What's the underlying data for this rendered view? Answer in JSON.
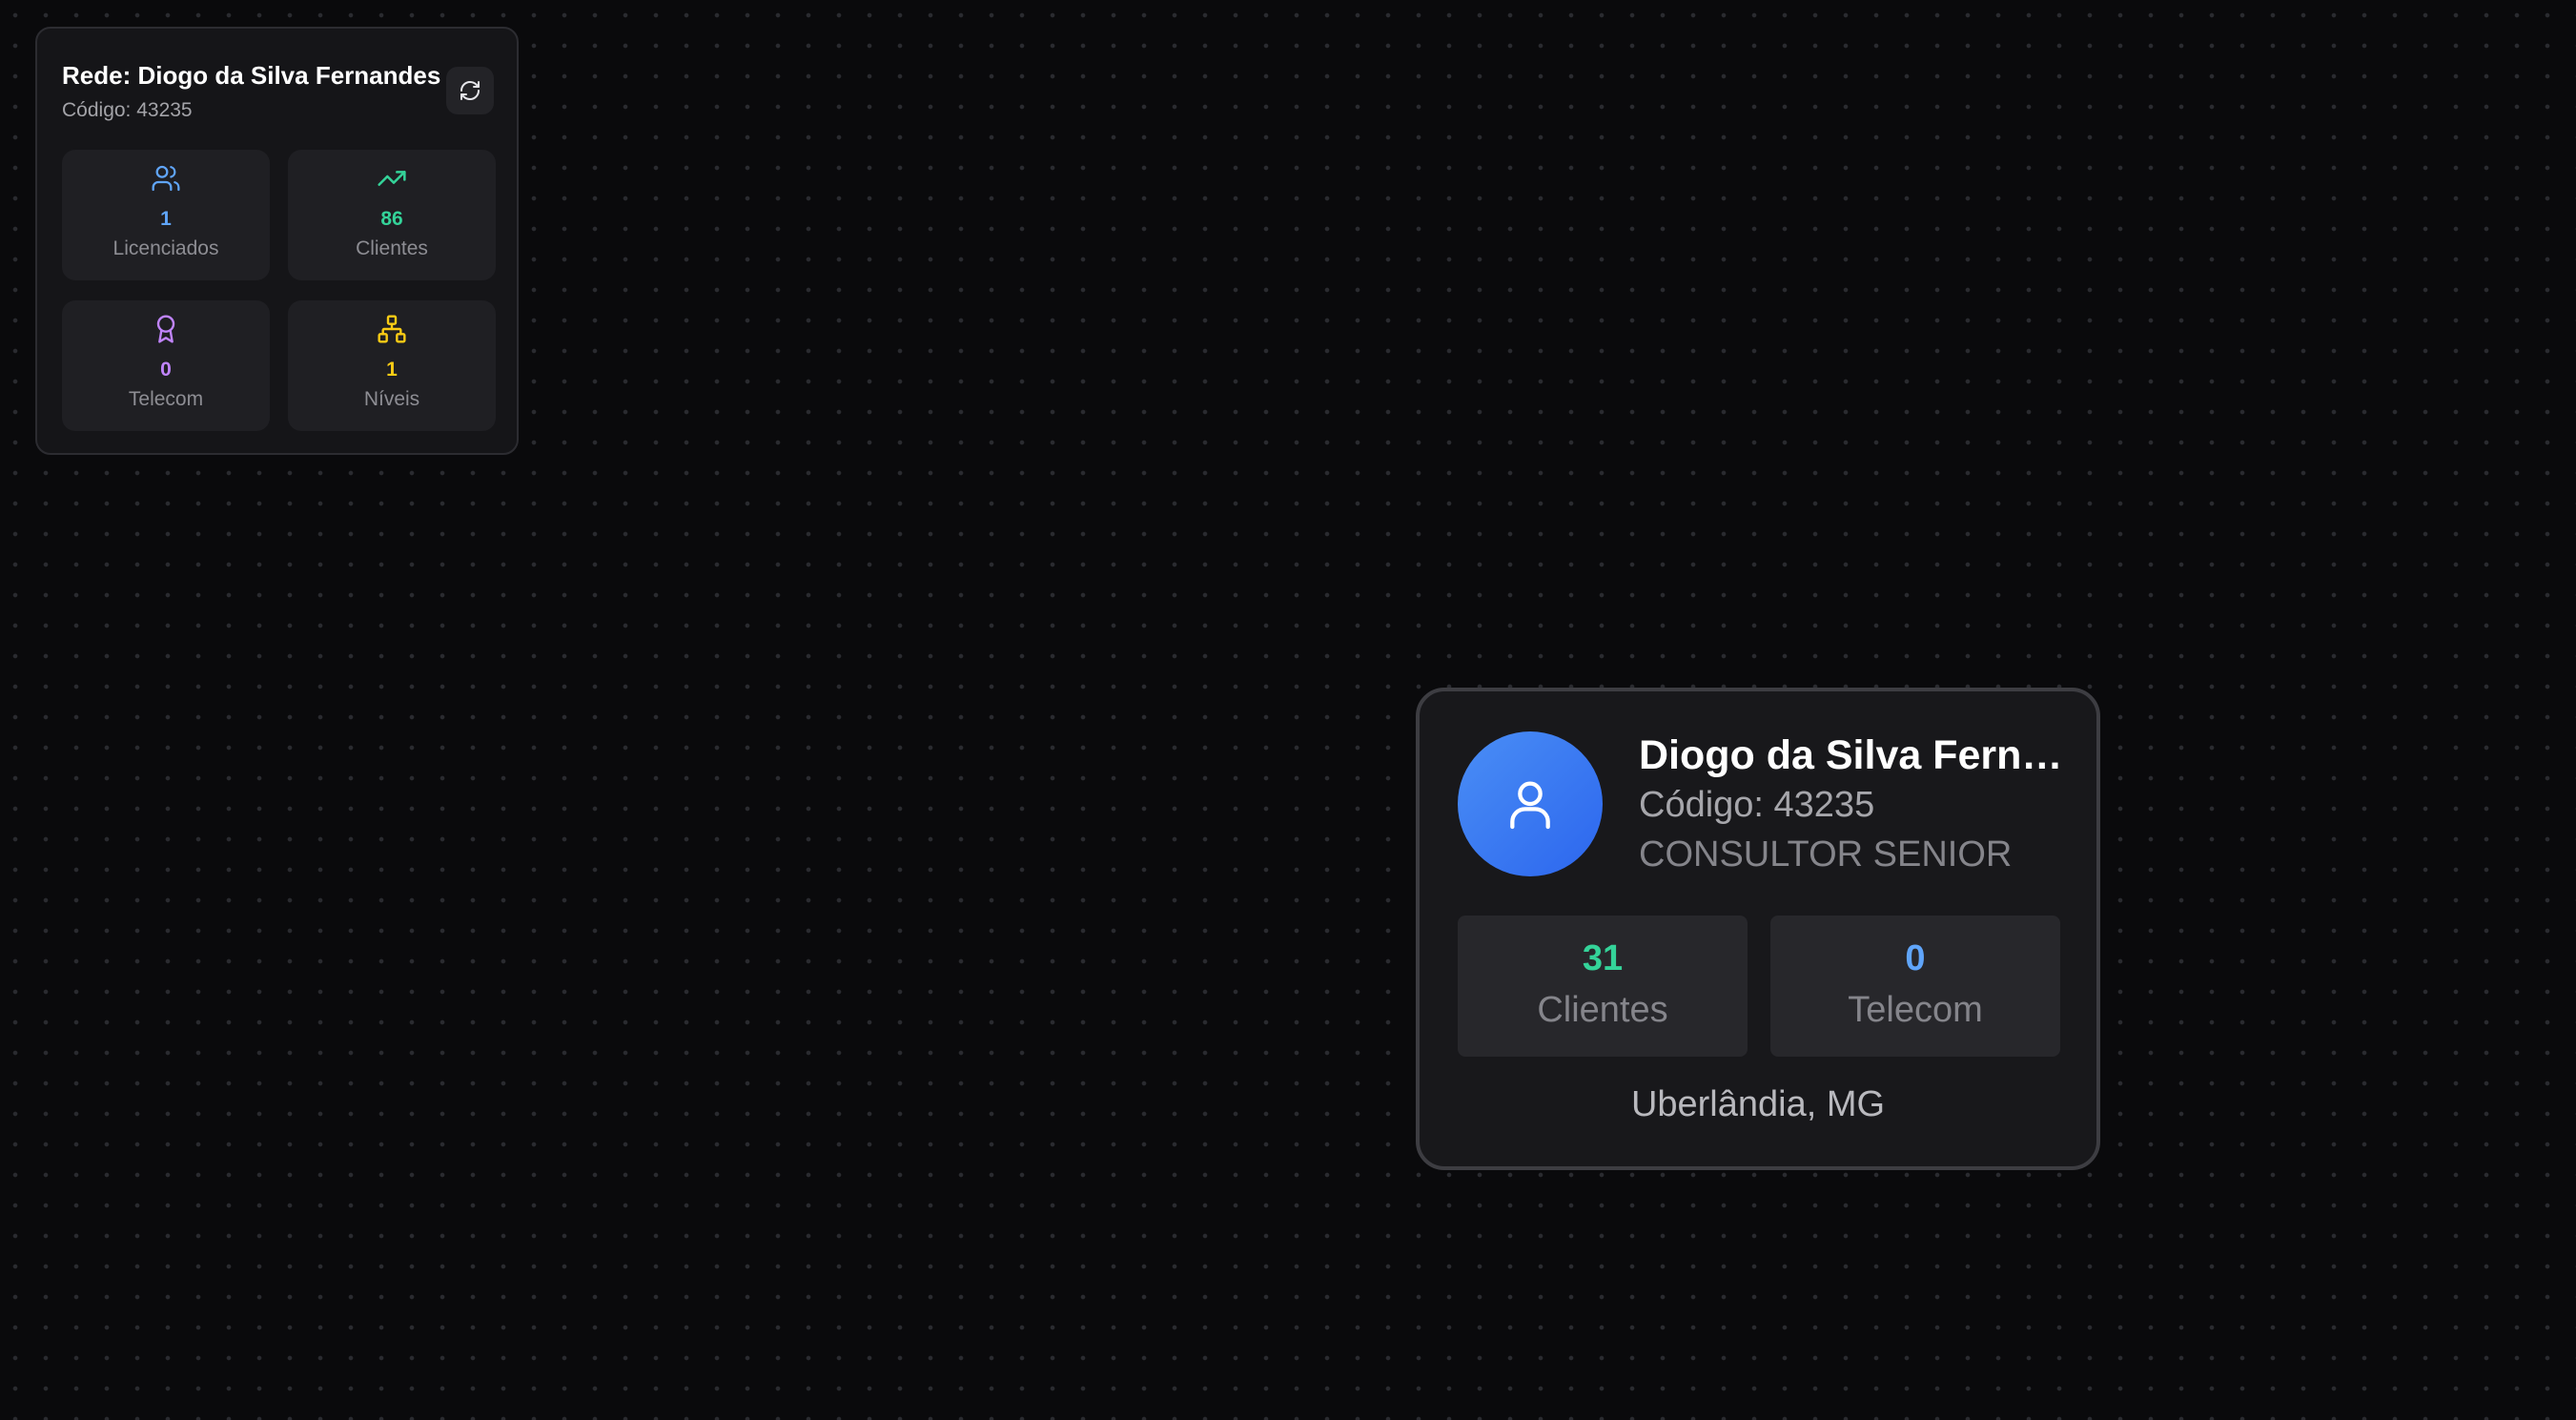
{
  "colors": {
    "background": "#0a0a0c",
    "panel": "#151518",
    "tile": "#1f1f23",
    "blue": "#60a5fa",
    "green": "#34d399",
    "purple": "#c084fc",
    "yellow": "#facc15",
    "avatar": "#3b7cf3"
  },
  "summary": {
    "title": "Rede: Diogo da Silva Fernandes",
    "code": "Código: 43235",
    "refresh_icon": "refresh-icon",
    "stats": [
      {
        "value": "1",
        "label": "Licenciados",
        "icon": "users-icon",
        "color": "#60a5fa"
      },
      {
        "value": "86",
        "label": "Clientes",
        "icon": "trending-up-icon",
        "color": "#34d399"
      },
      {
        "value": "0",
        "label": "Telecom",
        "icon": "award-icon",
        "color": "#c084fc"
      },
      {
        "value": "1",
        "label": "Níveis",
        "icon": "network-icon",
        "color": "#facc15"
      }
    ]
  },
  "node": {
    "name": "Diogo da Silva Ferna...",
    "code": "Código: 43235",
    "rank": "CONSULTOR SENIOR",
    "avatar_icon": "user-icon",
    "stats": [
      {
        "value": "31",
        "label": "Clientes",
        "color": "#34d399"
      },
      {
        "value": "0",
        "label": "Telecom",
        "color": "#60a5fa"
      }
    ],
    "location": "Uberlândia, MG"
  }
}
